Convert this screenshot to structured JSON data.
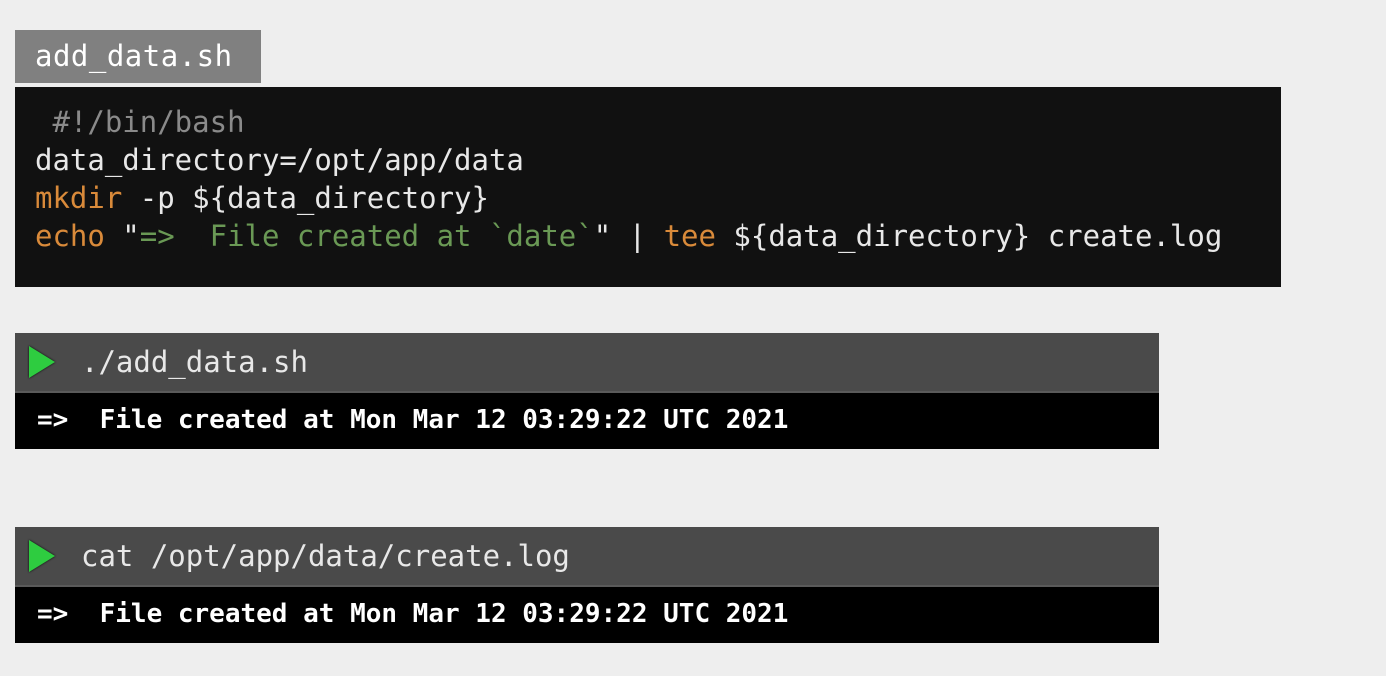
{
  "file": {
    "name": "add_data.sh",
    "line1_comment": "#!/bin/bash",
    "line2": "data_directory=/opt/app/data",
    "line3_cmd": "mkdir",
    "line3_rest": " -p ${data_directory}",
    "line4_cmd": "echo",
    "line4_str_open": " \"",
    "line4_str_body": "=>  File created at `date`",
    "line4_str_close": "\"",
    "line4_pipe": " | ",
    "line4_tee": "tee",
    "line4_rest": " ${data_directory} create.log"
  },
  "term1": {
    "command": "./add_data.sh",
    "output": "=>  File created at Mon Mar 12 03:29:22 UTC 2021"
  },
  "term2": {
    "command": "cat /opt/app/data/create.log",
    "output": "=>  File created at Mon Mar 12 03:29:22 UTC 2021"
  }
}
